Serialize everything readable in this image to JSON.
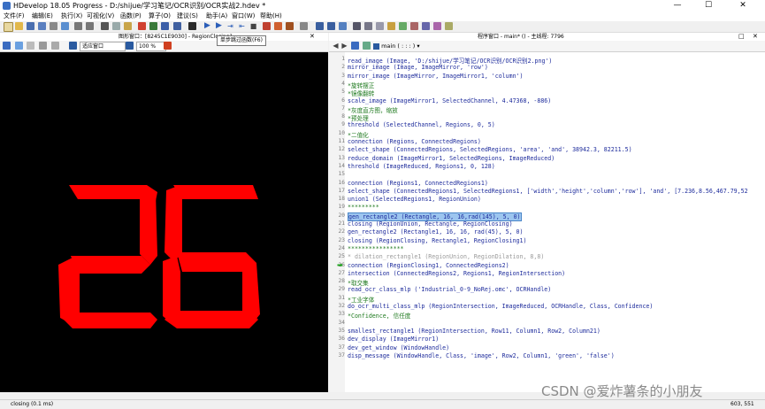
{
  "window": {
    "title": "HDevelop 18.05 Progress - D:/shijue/学习笔记/OCR识别/OCR实战2.hdev *",
    "minimize": "—",
    "maximize": "☐",
    "close": "✕"
  },
  "menu": {
    "items": [
      "文件(F)",
      "编辑(E)",
      "执行(X)",
      "可视化(V)",
      "函数(P)",
      "算子(O)",
      "建议(S)",
      "助手(A)",
      "窗口(W)",
      "帮助(H)"
    ]
  },
  "graphics_window": {
    "title": "图形窗口：[8245C1E9030] - RegionClosing1",
    "zoom_mode": "适应窗口",
    "zoom_percent": "100 %",
    "tooltip": "单步跳过函数(F6)",
    "displayed_digits": "26",
    "digit_color": "#ff0000",
    "background_color": "#000000"
  },
  "program_window": {
    "title": "程序窗口 - main* () - 主线程: 7796",
    "procedure": "main ( : : : )",
    "lines": [
      {
        "n": "1",
        "text": "read_image (Image, 'D:/shijue/学习笔记/OCR识别/OCR识别2.png')",
        "kind": "op"
      },
      {
        "n": "2",
        "text": "mirror_image (Image, ImageMirror, 'row')",
        "kind": "op"
      },
      {
        "n": "3",
        "text": "mirror_image (ImageMirror, ImageMirror1, 'column')",
        "kind": "op"
      },
      {
        "n": "4",
        "text": "*旋转摆正",
        "kind": "cm"
      },
      {
        "n": "5",
        "text": "*镜像翻转",
        "kind": "cm"
      },
      {
        "n": "6",
        "text": "scale_image (ImageMirror1, SelectedChannel, 4.47368, -886)",
        "kind": "op"
      },
      {
        "n": "7",
        "text": "*灰度直方图，缩放",
        "kind": "cm"
      },
      {
        "n": "8",
        "text": "*预处理",
        "kind": "cm"
      },
      {
        "n": "9",
        "text": "threshold (SelectedChannel, Regions, 0, 5)",
        "kind": "op"
      },
      {
        "n": "10",
        "text": "*二值化",
        "kind": "cm"
      },
      {
        "n": "11",
        "text": "connection (Regions, ConnectedRegions)",
        "kind": "op"
      },
      {
        "n": "12",
        "text": "select_shape (ConnectedRegions, SelectedRegions, 'area', 'and', 38942.3, 82211.5)",
        "kind": "op"
      },
      {
        "n": "13",
        "text": "reduce_domain (ImageMirror1, SelectedRegions, ImageReduced)",
        "kind": "op"
      },
      {
        "n": "14",
        "text": "threshold (ImageReduced, Regions1, 0, 128)",
        "kind": "op"
      },
      {
        "n": "15",
        "text": "",
        "kind": "op"
      },
      {
        "n": "16",
        "text": "connection (Regions1, ConnectedRegions1)",
        "kind": "op"
      },
      {
        "n": "17",
        "text": "select_shape (ConnectedRegions1, SelectedRegions1, ['width','height','column','row'], 'and', [7.236,8.56,467.79,52",
        "kind": "op"
      },
      {
        "n": "18",
        "text": "union1 (SelectedRegions1, RegionUnion)",
        "kind": "op"
      },
      {
        "n": "19",
        "text": "*********",
        "kind": "cm"
      },
      {
        "n": "20",
        "text": "gen_rectangle2 (Rectangle, 16, 16,rad(145), 5, 0)",
        "kind": "sel"
      },
      {
        "n": "21",
        "text": "closing (RegionUnion, Rectangle, RegionClosing)",
        "kind": "op"
      },
      {
        "n": "22",
        "text": "gen_rectangle2 (Rectangle1, 16, 16, rad(45), 5, 0)",
        "kind": "op"
      },
      {
        "n": "23",
        "text": "closing (RegionClosing, Rectangle1, RegionClosing1)",
        "kind": "op"
      },
      {
        "n": "24",
        "text": "****************",
        "kind": "cm"
      },
      {
        "n": "25",
        "text": "* dilation_rectangle1 (RegionUnion, RegionDilation, 8,8)",
        "kind": "cmg"
      },
      {
        "n": "26",
        "text": "connection (RegionClosing1, ConnectedRegions2)",
        "kind": "op"
      },
      {
        "n": "27",
        "text": "intersection (ConnectedRegions2, Regions1, RegionIntersection)",
        "kind": "op"
      },
      {
        "n": "28",
        "text": "*取交集",
        "kind": "cm"
      },
      {
        "n": "29",
        "text": "read_ocr_class_mlp ('Industrial_0-9_NoRej.omc', OCRHandle)",
        "kind": "op"
      },
      {
        "n": "31",
        "text": "*工业字体",
        "kind": "cm"
      },
      {
        "n": "32",
        "text": "do_ocr_multi_class_mlp (RegionIntersection, ImageReduced, OCRHandle, Class, Confidence)",
        "kind": "op"
      },
      {
        "n": "33",
        "text": "*Confidence, 信任度",
        "kind": "cm"
      },
      {
        "n": "34",
        "text": "",
        "kind": "op"
      },
      {
        "n": "35",
        "text": "smallest_rectangle1 (RegionIntersection, Row11, Column1, Row2, Column21)",
        "kind": "op"
      },
      {
        "n": "36",
        "text": "dev_display (ImageMirror1)",
        "kind": "op"
      },
      {
        "n": "37",
        "text": "dev_get_window (WindowHandle)",
        "kind": "op"
      },
      {
        "n": "37",
        "text": "disp_message (WindowHandle, Class, 'image', Row2, Column1, 'green', 'false')",
        "kind": "op"
      }
    ]
  },
  "status": {
    "left": "closing (0.1 ms)",
    "right": "603, 551"
  },
  "watermark": "CSDN @爱炸薯条的小朋友"
}
